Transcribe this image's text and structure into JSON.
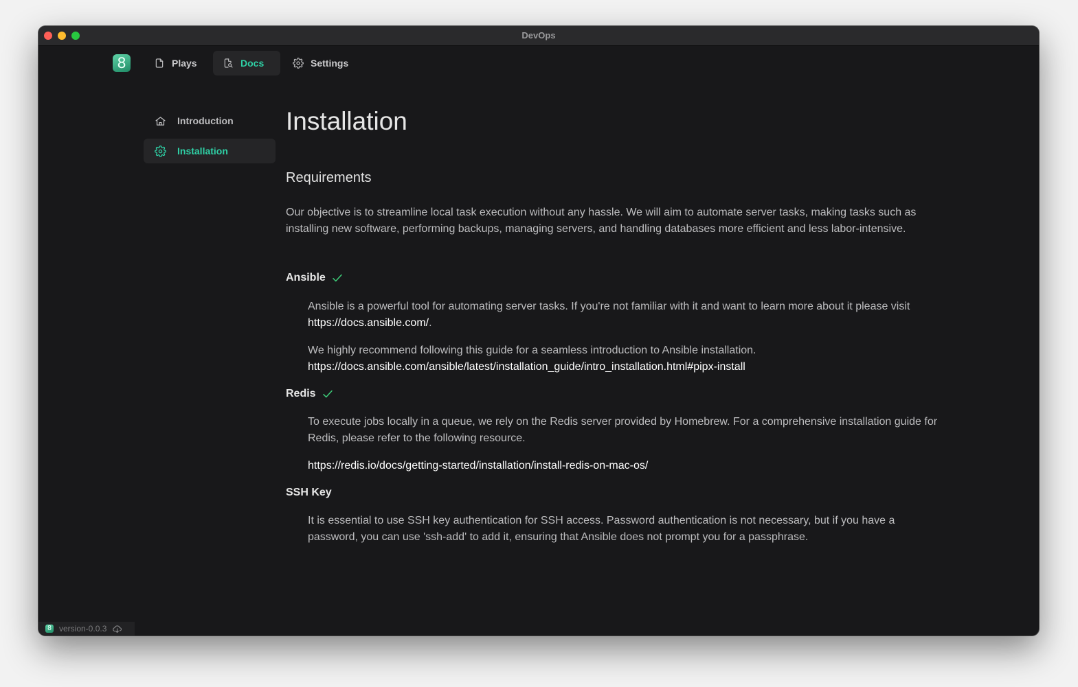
{
  "window": {
    "title": "DevOps"
  },
  "app": {
    "logo_glyph": "8"
  },
  "nav": {
    "tabs": [
      {
        "label": "Plays",
        "icon": "file-icon"
      },
      {
        "label": "Docs",
        "icon": "file-search-icon",
        "active": true
      },
      {
        "label": "Settings",
        "icon": "gear-icon"
      }
    ]
  },
  "sidebar": {
    "items": [
      {
        "label": "Introduction",
        "icon": "home-icon"
      },
      {
        "label": "Installation",
        "icon": "gear-icon",
        "active": true
      }
    ]
  },
  "doc": {
    "title": "Installation",
    "requirements_heading": "Requirements",
    "intro": "Our objective is to streamline local task execution without any hassle. We will aim to automate server tasks, making tasks such as installing new software, performing backups, managing servers, and handling databases more efficient and less labor-intensive.",
    "ansible": {
      "heading": "Ansible",
      "p1": "Ansible is a powerful tool for automating server tasks. If you're not familiar with it and want to learn more about it please visit",
      "p1_link": "https://docs.ansible.com/",
      "p1_end": ".",
      "p2": "We highly recommend following this guide for a seamless introduction to Ansible installation.",
      "p2_link": "https://docs.ansible.com/ansible/latest/installation_guide/intro_installation.html#pipx-install"
    },
    "redis": {
      "heading": "Redis",
      "p1": "To execute jobs locally in a queue, we rely on the Redis server provided by Homebrew. For a comprehensive installation guide for Redis, please refer to the following resource.",
      "link": "https://redis.io/docs/getting-started/installation/install-redis-on-mac-os/"
    },
    "ssh": {
      "heading": "SSH Key",
      "p1": "It is essential to use SSH key authentication for SSH access. Password authentication is not necessary, but if you have a password, you can use 'ssh-add' to add it, ensuring that Ansible does not prompt you for a passphrase."
    }
  },
  "status_bar": {
    "version": "version-0.0.3",
    "icon": "cloud-download-icon"
  },
  "colors": {
    "accent": "#2fd1a6",
    "check": "#3ecf7a",
    "background": "#18181a"
  }
}
